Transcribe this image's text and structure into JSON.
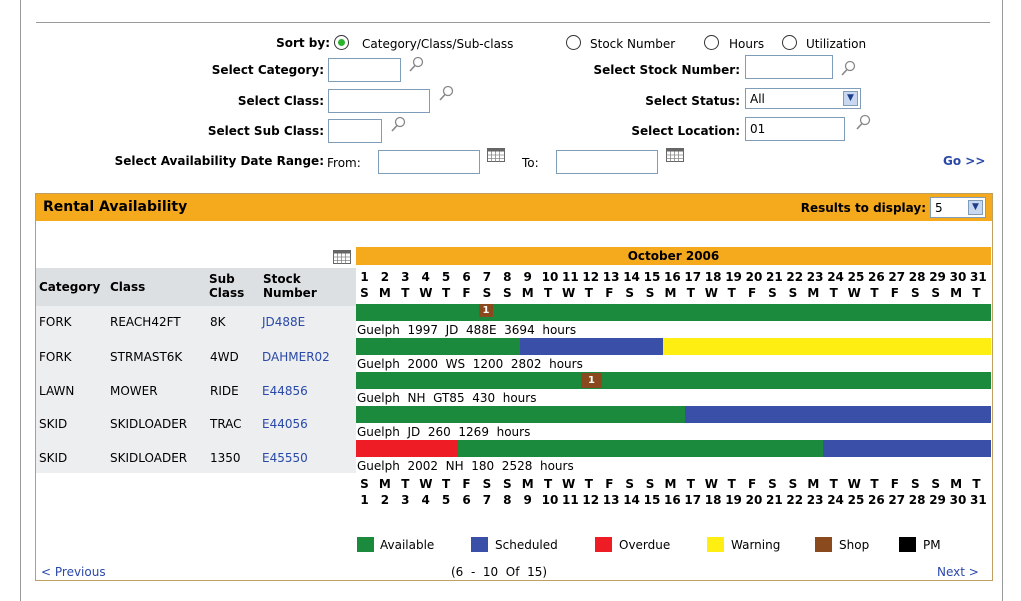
{
  "filters": {
    "sort_by_label": "Sort by:",
    "sort_options": [
      "Category/Class/Sub-class",
      "Stock Number",
      "Hours",
      "Utilization"
    ],
    "select_category_label": "Select Category:",
    "select_class_label": "Select Class:",
    "select_sub_class_label": "Select Sub Class:",
    "select_stock_number_label": "Select Stock Number:",
    "select_status_label": "Select Status:",
    "status_value": "All",
    "select_location_label": "Select Location:",
    "location_value": "01",
    "date_range_label": "Select Availability Date Range:",
    "from_label": "From:",
    "to_label": "To:",
    "go_label": "Go >>"
  },
  "panel": {
    "title": "Rental Availability",
    "results_label": "Results to display:",
    "results_value": "5",
    "month_label": "October 2006"
  },
  "table": {
    "headers": {
      "category": "Category",
      "class": "Class",
      "sub_class": "Sub Class",
      "stock_number": "Stock Number"
    },
    "rows": [
      {
        "category": "FORK",
        "class": "REACH42FT",
        "sub_class": "8K",
        "stock": "JD488E",
        "desc": "Guelph  1997  JD  488E  3694  hours"
      },
      {
        "category": "FORK",
        "class": "STRMAST6K",
        "sub_class": "4WD",
        "stock": "DAHMER02",
        "desc": "Guelph  2000  WS  1200  2802  hours"
      },
      {
        "category": "LAWN",
        "class": "MOWER",
        "sub_class": "RIDE",
        "stock": "E44856",
        "desc": "Guelph  NH  GT85  430  hours"
      },
      {
        "category": "SKID",
        "class": "SKIDLOADER",
        "sub_class": "TRAC",
        "stock": "E44056",
        "desc": "Guelph  JD  260  1269  hours"
      },
      {
        "category": "SKID",
        "class": "SKIDLOADER",
        "sub_class": "1350",
        "stock": "E45550",
        "desc": "Guelph  2002  NH  180  2528  hours"
      }
    ]
  },
  "calendar": {
    "days": [
      "1",
      "2",
      "3",
      "4",
      "5",
      "6",
      "7",
      "8",
      "9",
      "10",
      "11",
      "12",
      "13",
      "14",
      "15",
      "16",
      "17",
      "18",
      "19",
      "20",
      "21",
      "22",
      "23",
      "24",
      "25",
      "26",
      "27",
      "28",
      "29",
      "30",
      "31"
    ],
    "weekdays": [
      "S",
      "M",
      "T",
      "W",
      "T",
      "F",
      "S",
      "S",
      "M",
      "T",
      "W",
      "T",
      "F",
      "S",
      "S",
      "M",
      "T",
      "W",
      "T",
      "F",
      "S",
      "S",
      "M",
      "T",
      "W",
      "T",
      "F",
      "S",
      "S",
      "M",
      "T"
    ],
    "shop_marker": "1"
  },
  "legend": [
    {
      "label": "Available",
      "color": "#1c8a3c"
    },
    {
      "label": "Scheduled",
      "color": "#3a4fa8"
    },
    {
      "label": "Overdue",
      "color": "#ee1c24"
    },
    {
      "label": "Warning",
      "color": "#ffee11"
    },
    {
      "label": "Shop",
      "color": "#8b4a1e"
    },
    {
      "label": "PM",
      "color": "#000000"
    }
  ],
  "pagination": {
    "previous": "< Previous",
    "status": "(6  -  10  Of  15)",
    "next": "Next >"
  }
}
